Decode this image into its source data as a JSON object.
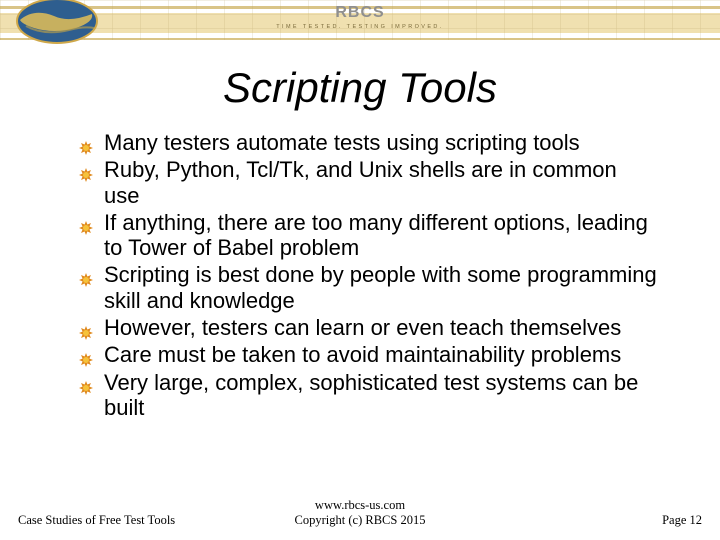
{
  "header": {
    "brand": "RBCS",
    "tagline": "TIME TESTED. TESTING IMPROVED."
  },
  "title": "Scripting Tools",
  "bullets": [
    "Many testers automate tests using scripting tools",
    "Ruby, Python, Tcl/Tk, and Unix shells are in common use",
    "If anything, there are too many different options, leading to Tower of Babel problem",
    "Scripting is best done by people with some programming skill and knowledge",
    "However, testers can learn or even teach themselves",
    "Care must be taken to avoid maintainability problems",
    "Very large, complex, sophisticated test systems can be built"
  ],
  "footer": {
    "left": "Case Studies of Free Test Tools",
    "center_line1": "www.rbcs-us.com",
    "center_line2": "Copyright (c) RBCS 2015",
    "right": "Page 12"
  },
  "colors": {
    "bullet_outer": "#e08a1e",
    "bullet_inner": "#f6c23a"
  }
}
